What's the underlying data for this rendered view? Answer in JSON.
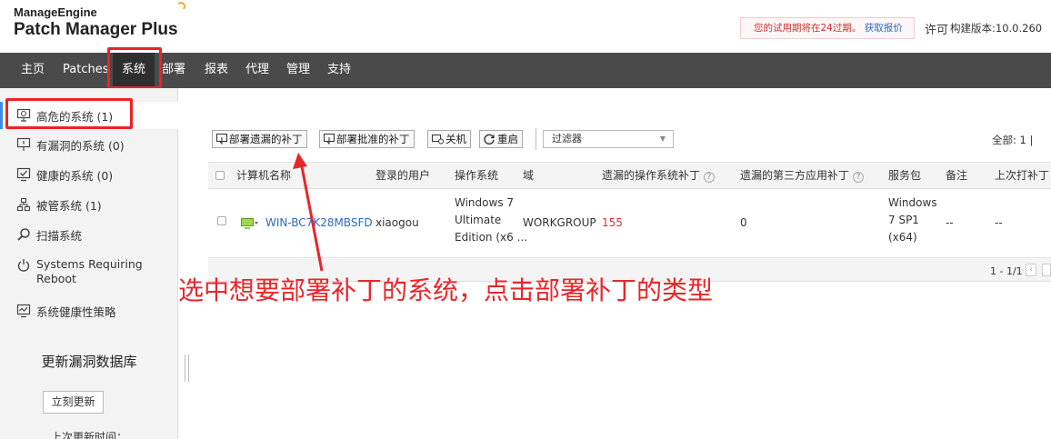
{
  "header": {
    "logo_company": "ManageEngine",
    "logo_product": "Patch Manager Plus",
    "trial_text": "您的试用期将在24过期。",
    "trial_link": "获取报价",
    "license": "许可",
    "build": "构建版本:10.0.260"
  },
  "nav": {
    "items": [
      {
        "label": "主页"
      },
      {
        "label": "Patches"
      },
      {
        "label": "系统"
      },
      {
        "label": "部署"
      },
      {
        "label": "报表"
      },
      {
        "label": "代理"
      },
      {
        "label": "管理"
      },
      {
        "label": "支持"
      }
    ],
    "active": "系统"
  },
  "sidebar": {
    "items": [
      {
        "label": "高危的系统 (1)",
        "icon": "monitor-alert-icon"
      },
      {
        "label": "有漏洞的系统 (0)",
        "icon": "monitor-warning-icon"
      },
      {
        "label": "健康的系统 (0)",
        "icon": "monitor-check-icon"
      },
      {
        "label": "被管系统 (1)",
        "icon": "network-icon"
      },
      {
        "label": "扫描系统",
        "icon": "search-icon"
      },
      {
        "label": "Systems Requiring",
        "label2": "Reboot",
        "icon": "power-icon"
      },
      {
        "label": "系统健康性策略",
        "icon": "monitor-chart-icon"
      }
    ],
    "db_title": "更新漏洞数据库",
    "db_button": "立刻更新",
    "db_last": "上次更新时间："
  },
  "toolbar": {
    "deploy_missing": "部署遗漏的补丁",
    "deploy_approved": "部署批准的补丁",
    "shutdown": "关机",
    "restart": "重启",
    "filter": "过滤器",
    "total": "全部: 1  |"
  },
  "table": {
    "columns": [
      "计算机名称",
      "登录的用户",
      "操作系统",
      "域",
      "遗漏的操作系统补丁",
      "遗漏的第三方应用补丁",
      "服务包",
      "备注",
      "上次打补丁"
    ],
    "rows": [
      {
        "computer": "WIN-BC7K28MBSFD",
        "user": "xiaogou",
        "os_line1": "Windows 7",
        "os_line2": "Ultimate",
        "os_line3": "Edition (x6 ...",
        "domain": "WORKGROUP",
        "missing_os": "155",
        "missing_third": "0",
        "sp_line1": "Windows",
        "sp_line2": "7 SP1",
        "sp_line3": "(x64)",
        "remark": "--",
        "last_patch": "--"
      }
    ],
    "pager": "1 - 1/1"
  },
  "annotation": "选中想要部署补丁的系统，点击部署补丁的类型",
  "colors": {
    "nav_bg": "#4a4a4a",
    "highlight": "#ee2222",
    "link": "#2a6bc2",
    "danger": "#dd3333"
  }
}
